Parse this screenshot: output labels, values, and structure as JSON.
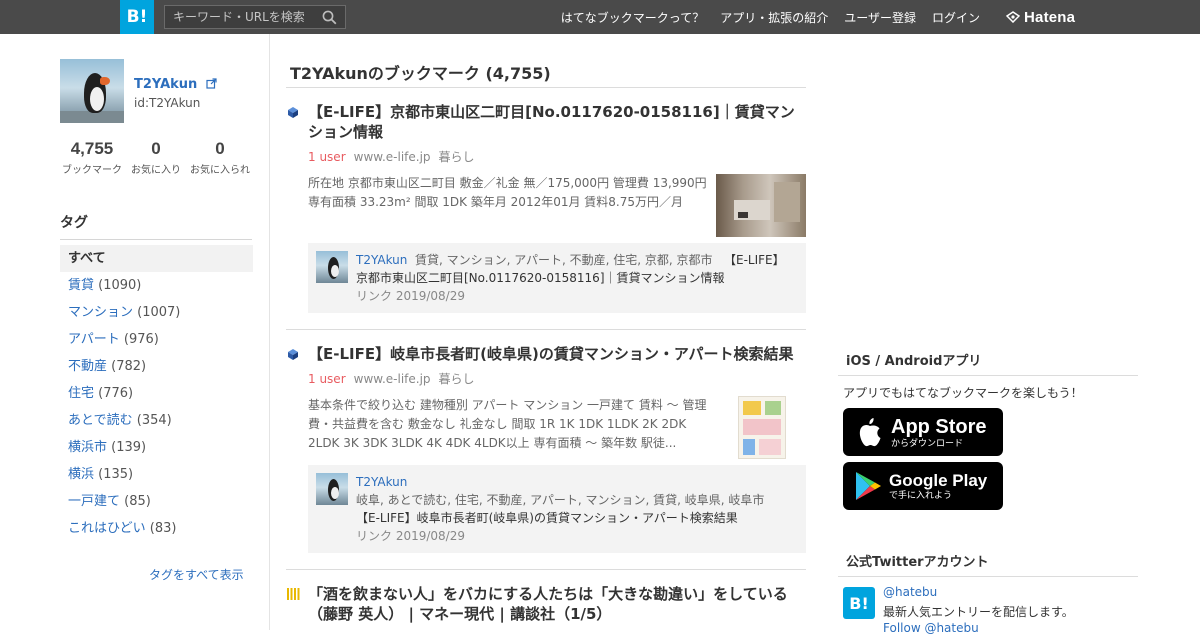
{
  "header": {
    "logo_text": "B!",
    "search_placeholder": "キーワード・URLを検索",
    "nav": [
      "はてなブックマークって？",
      "アプリ・拡張の紹介",
      "ユーザー登録",
      "ログイン"
    ],
    "brand": "Hatena"
  },
  "profile": {
    "name": "T2YAkun",
    "id": "id:T2YAkun",
    "stats": [
      {
        "num": "4,755",
        "label": "ブックマーク"
      },
      {
        "num": "0",
        "label": "お気に入り"
      },
      {
        "num": "0",
        "label": "お気に入られ"
      }
    ]
  },
  "tags": {
    "heading": "タグ",
    "all_label": "すべて",
    "items": [
      {
        "name": "賃貸",
        "count": "(1090)"
      },
      {
        "name": "マンション",
        "count": "(1007)"
      },
      {
        "name": "アパート",
        "count": "(976)"
      },
      {
        "name": "不動産",
        "count": "(782)"
      },
      {
        "name": "住宅",
        "count": "(776)"
      },
      {
        "name": "あとで読む",
        "count": "(354)"
      },
      {
        "name": "横浜市",
        "count": "(139)"
      },
      {
        "name": "横浜",
        "count": "(135)"
      },
      {
        "name": "一戸建て",
        "count": "(85)"
      },
      {
        "name": "これはひどい",
        "count": "(83)"
      }
    ],
    "show_all": "タグをすべて表示"
  },
  "main": {
    "title": "T2YAkunのブックマーク (4,755)",
    "entries": [
      {
        "title": "【E-LIFE】京都市東山区二町目[No.0117620-0158116]｜賃貸マンション情報",
        "users": "1 user",
        "domain": "www.e-life.jp",
        "category": "暮らし",
        "summary_line1": "所在地 京都市東山区二町目 敷金／礼金 無／175,000円 管理費 13,990円",
        "summary_line2": "専有面積 33.23m² 間取 1DK 築年月 2012年01月 賃料8.75万円／月",
        "comment_user": "T2YAkun",
        "comment_tags": "賃貸, マンション, アパート, 不動産, 住宅, 京都, 京都市",
        "comment_text_a": "【E-LIFE】",
        "comment_text_b": "京都市東山区二町目[No.0117620-0158116]｜賃貸マンション情報",
        "comment_date": "リンク 2019/08/29"
      },
      {
        "title": "【E-LIFE】岐阜市長者町(岐阜県)の賃貸マンション・アパート検索結果",
        "users": "1 user",
        "domain": "www.e-life.jp",
        "category": "暮らし",
        "summary_line1": "基本条件で絞り込む 建物種別 アパート マンション 一戸建て 賃料 〜 管理",
        "summary_line2": "費・共益費を含む 敷金なし 礼金なし 間取 1R 1K 1DK 1LDK 2K 2DK",
        "summary_line3": "2LDK 3K 3DK 3LDK 4K 4DK 4LDK以上 専有面積 〜 築年数 駅徒...",
        "comment_user": "T2YAkun",
        "comment_tags": "岐阜, あとで読む, 住宅, 不動産, アパート, マンション, 賃貸, 岐阜県, 岐阜市",
        "comment_text": "【E-LIFE】岐阜市長者町(岐阜県)の賃貸マンション・アパート検索結果",
        "comment_date": "リンク 2019/08/29"
      },
      {
        "title": "「酒を飲まない人」をバカにする人たちは「大きな勘違い」をしている",
        "title_line2": "（藤野 英人） | マネー現代 | 講談社（1/5）"
      }
    ]
  },
  "sidebar_right": {
    "apps_heading": "iOS / Androidアプリ",
    "apps_text": "アプリでもはてなブックマークを楽しもう！",
    "appstore_big": "App Store",
    "appstore_small": "からダウンロード",
    "googleplay_big": "Google Play",
    "googleplay_small": "で手に入れよう",
    "twitter_heading": "公式Twitterアカウント",
    "twitter_icon_text": "B!",
    "twitter_handle": "@hatebu",
    "twitter_desc": "最新人気エントリーを配信します。",
    "twitter_follow": "Follow @hatebu"
  },
  "colors": {
    "header_bg": "#4a4a4a",
    "brand_blue": "#00a4de",
    "link_blue": "#2c6ebd",
    "users_red": "#e85b60"
  },
  "icons": [
    "search-icon",
    "external-link-icon",
    "hatena-logo-icon",
    "apple-icon",
    "google-play-icon",
    "favicon-icon"
  ]
}
